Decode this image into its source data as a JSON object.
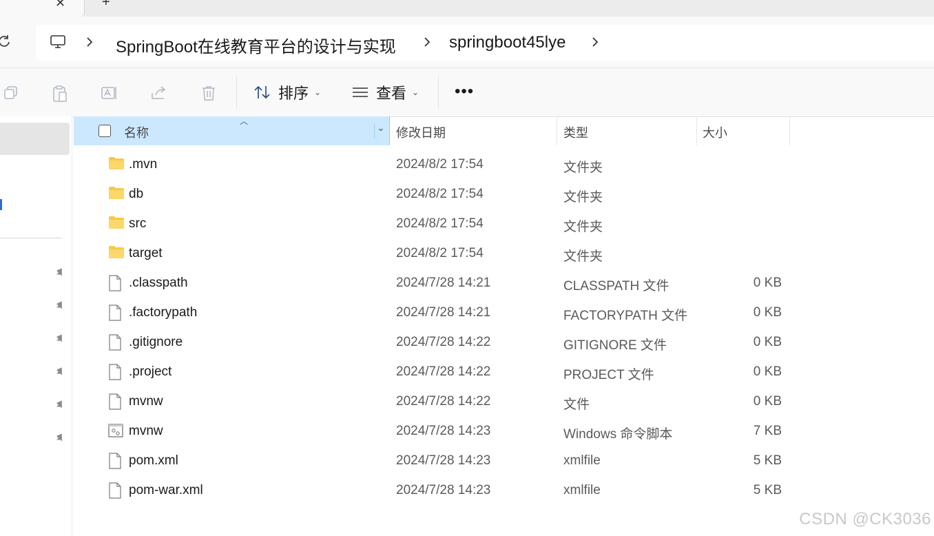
{
  "window": {
    "tab_close": "✕",
    "tab_new": "+"
  },
  "address": {
    "refresh_icon": "refresh-icon",
    "breadcrumbs": [
      "SpringBoot在线教育平台的设计与实现",
      "springboot45lye"
    ]
  },
  "toolbar": {
    "sort_label": "排序",
    "view_label": "查看",
    "more_label": "•••"
  },
  "columns": {
    "name": "名称",
    "date": "修改日期",
    "type": "类型",
    "size": "大小"
  },
  "files": [
    {
      "name": ".mvn",
      "date": "2024/8/2 17:54",
      "type": "文件夹",
      "size": "",
      "icon": "folder-icon"
    },
    {
      "name": "db",
      "date": "2024/8/2 17:54",
      "type": "文件夹",
      "size": "",
      "icon": "folder-icon"
    },
    {
      "name": "src",
      "date": "2024/8/2 17:54",
      "type": "文件夹",
      "size": "",
      "icon": "folder-icon"
    },
    {
      "name": "target",
      "date": "2024/8/2 17:54",
      "type": "文件夹",
      "size": "",
      "icon": "folder-icon"
    },
    {
      "name": ".classpath",
      "date": "2024/7/28 14:21",
      "type": "CLASSPATH 文件",
      "size": "0 KB",
      "icon": "file-icon"
    },
    {
      "name": ".factorypath",
      "date": "2024/7/28 14:21",
      "type": "FACTORYPATH 文件",
      "size": "0 KB",
      "icon": "file-icon"
    },
    {
      "name": ".gitignore",
      "date": "2024/7/28 14:22",
      "type": "GITIGNORE 文件",
      "size": "0 KB",
      "icon": "file-icon"
    },
    {
      "name": ".project",
      "date": "2024/7/28 14:22",
      "type": "PROJECT 文件",
      "size": "0 KB",
      "icon": "file-icon"
    },
    {
      "name": "mvnw",
      "date": "2024/7/28 14:22",
      "type": "文件",
      "size": "0 KB",
      "icon": "file-icon"
    },
    {
      "name": "mvnw",
      "date": "2024/7/28 14:23",
      "type": "Windows 命令脚本",
      "size": "7 KB",
      "icon": "script-icon"
    },
    {
      "name": "pom.xml",
      "date": "2024/7/28 14:23",
      "type": "xmlfile",
      "size": "5 KB",
      "icon": "file-icon"
    },
    {
      "name": "pom-war.xml",
      "date": "2024/7/28 14:23",
      "type": "xmlfile",
      "size": "5 KB",
      "icon": "file-icon"
    }
  ],
  "watermark": "CSDN @CK3036",
  "colors": {
    "header_selected": "#cce8ff",
    "folder": "#f7c948",
    "nav_selected": "#e5e5e5"
  }
}
